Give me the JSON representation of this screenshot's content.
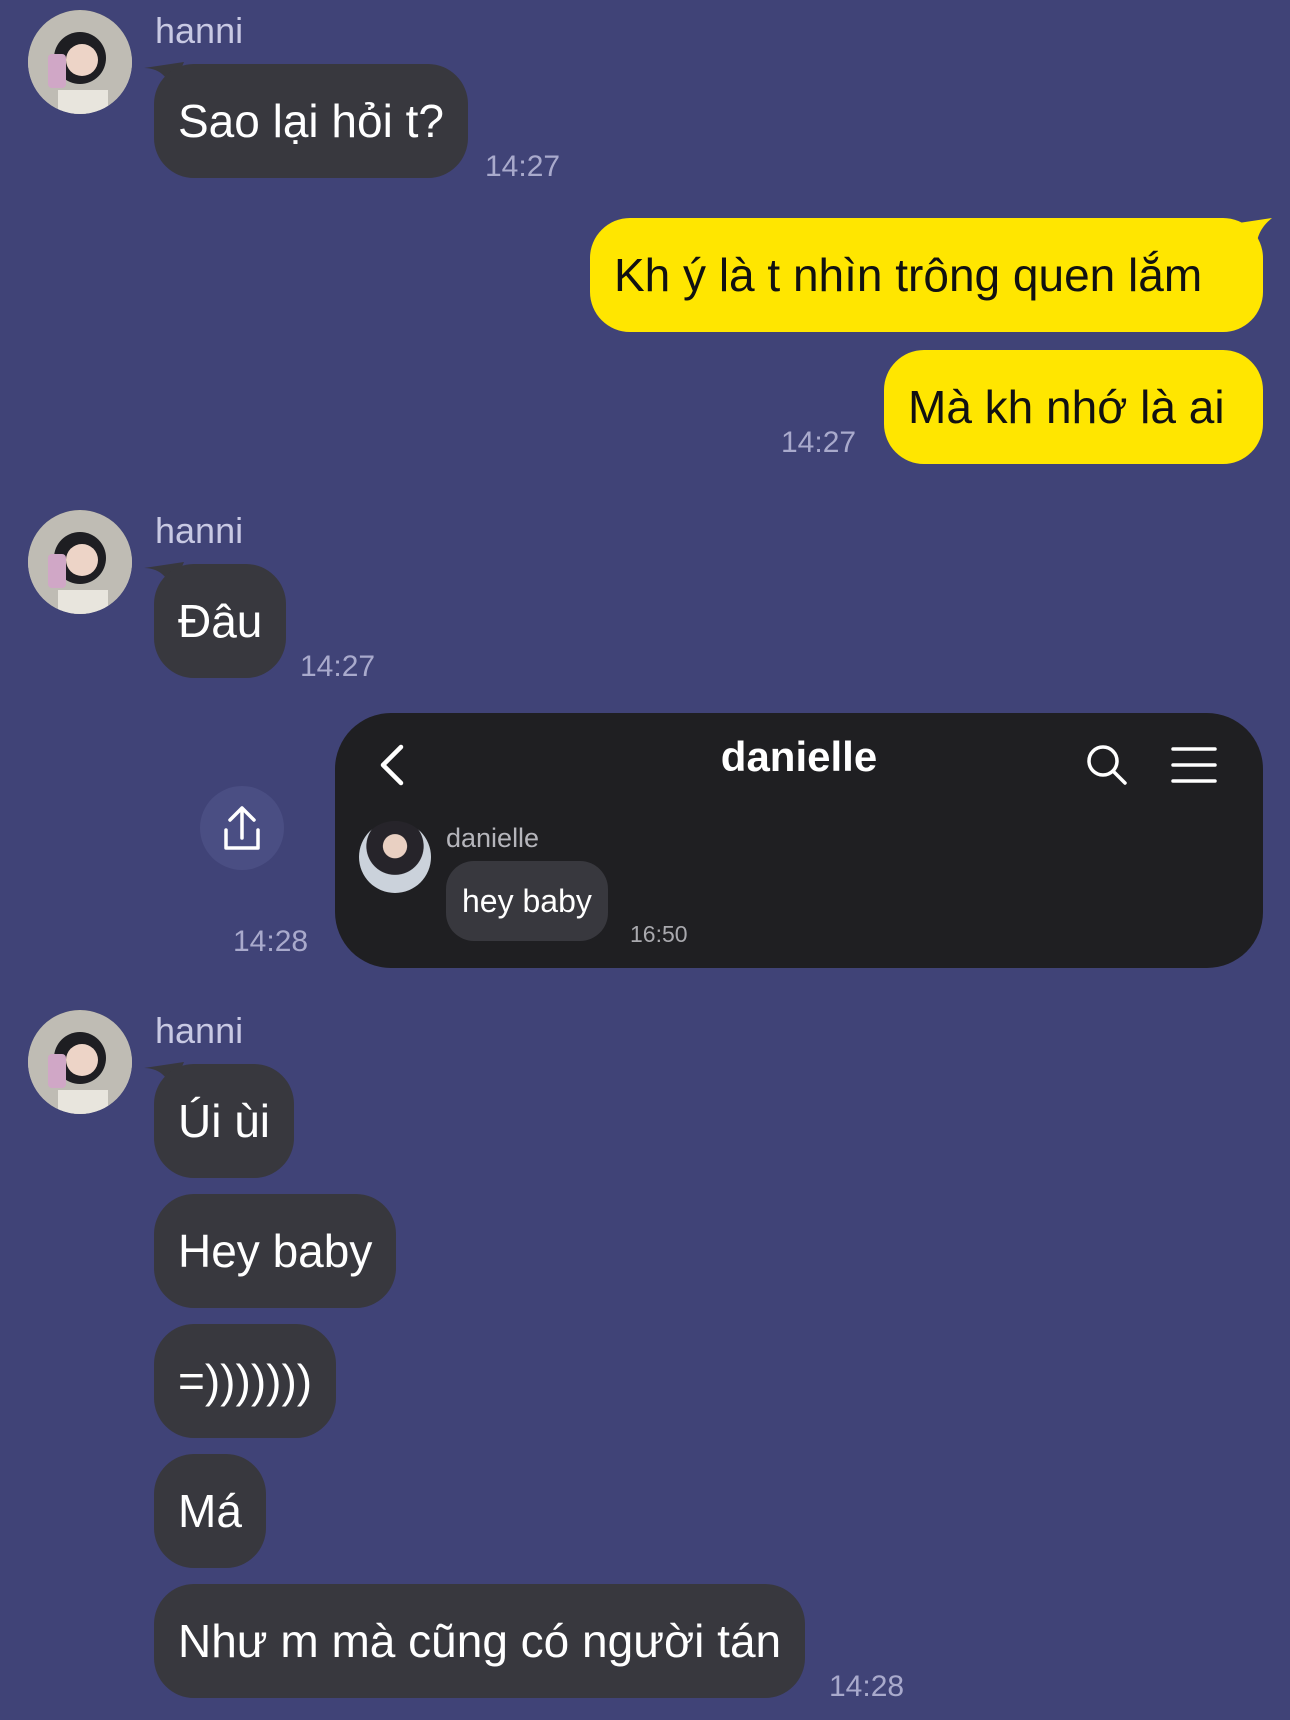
{
  "messages": {
    "m1": {
      "sender": "hanni",
      "text": "Sao lại hỏi t?",
      "time": "14:27"
    },
    "m2": {
      "text1": "Kh ý là t nhìn trông quen lắm",
      "text2": "Mà kh nhớ là ai",
      "time": "14:27"
    },
    "m3": {
      "sender": "hanni",
      "text": "Đâu",
      "time": "14:27"
    },
    "m4": {
      "time": "14:28",
      "card": {
        "title": "danielle",
        "sender": "danielle",
        "text": "hey baby",
        "time": "16:50"
      }
    },
    "m5": {
      "sender": "hanni",
      "lines": [
        "Úi ùi",
        "Hey baby",
        "=)))))))",
        "Má",
        "Như m mà cũng có người tán"
      ],
      "time": "14:28"
    }
  },
  "colors": {
    "background": "#404377",
    "incoming_bubble": "#38383e",
    "outgoing_bubble": "#ffe600"
  }
}
